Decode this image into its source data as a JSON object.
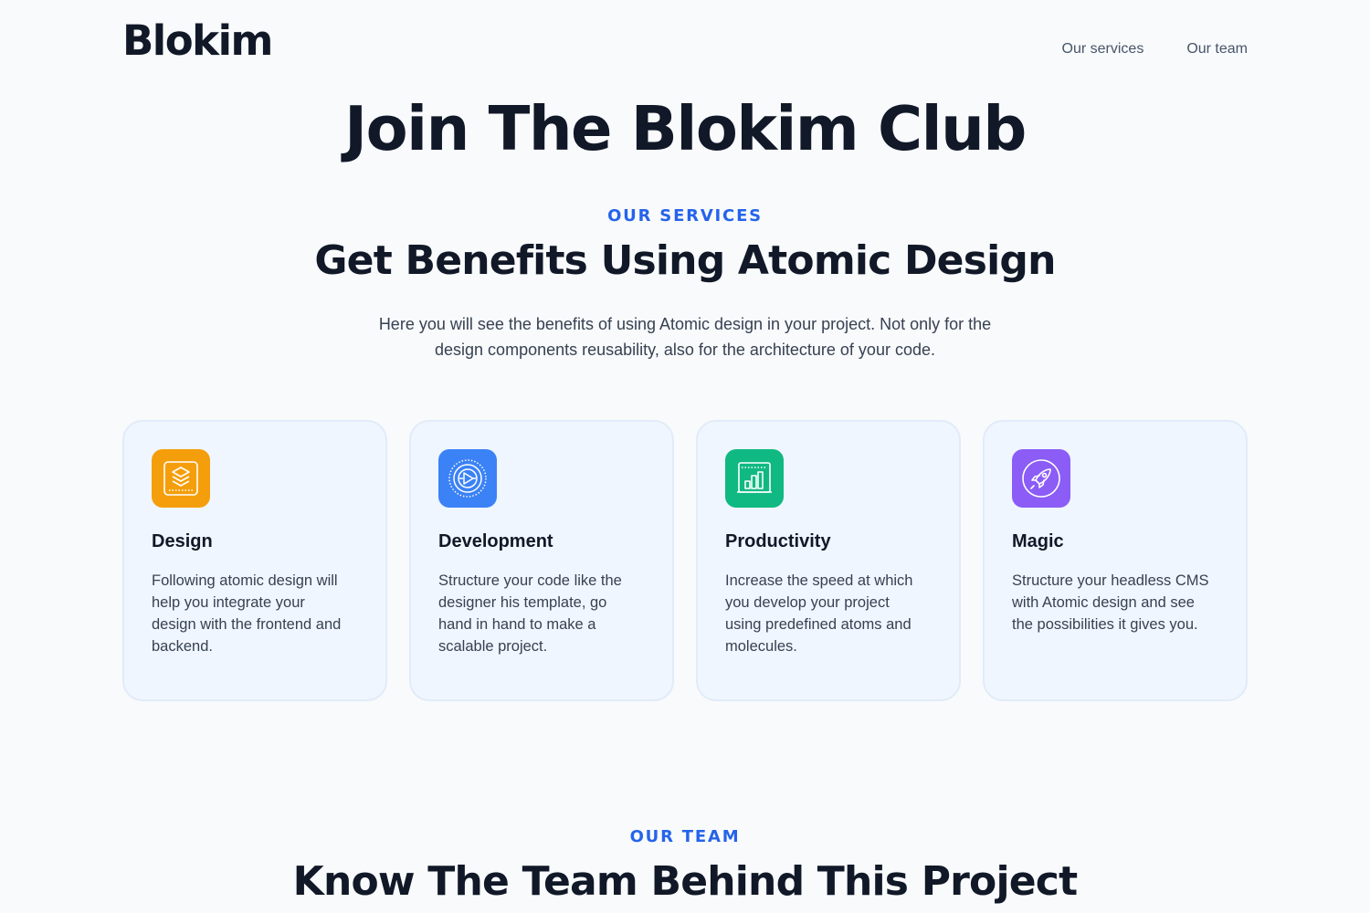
{
  "header": {
    "logo": "Blokim",
    "nav": [
      {
        "label": "Our services"
      },
      {
        "label": "Our team"
      }
    ]
  },
  "hero": {
    "title": "Join The Blokim Club"
  },
  "services": {
    "eyebrow": "OUR SERVICES",
    "title": "Get Benefits Using Atomic Design",
    "description": "Here you will see the benefits of using Atomic design in your project. Not only for the design components reusability, also for the architecture of your code.",
    "cards": [
      {
        "icon": "layers-icon",
        "color": "#f59e0b",
        "title": "Design",
        "text": "Following atomic design will help you integrate your design with the frontend and backend."
      },
      {
        "icon": "target-icon",
        "color": "#3b82f6",
        "title": "Development",
        "text": "Structure your code like the designer his template, go hand in hand to make a scalable project."
      },
      {
        "icon": "bar-chart-icon",
        "color": "#10b981",
        "title": "Productivity",
        "text": "Increase the speed at which you develop your project using predefined atoms and molecules."
      },
      {
        "icon": "rocket-icon",
        "color": "#8b5cf6",
        "title": "Magic",
        "text": "Structure your headless CMS with Atomic design and see the possibilities it gives you."
      }
    ]
  },
  "team": {
    "eyebrow": "OUR TEAM",
    "title": "Know The Team Behind This Project"
  }
}
